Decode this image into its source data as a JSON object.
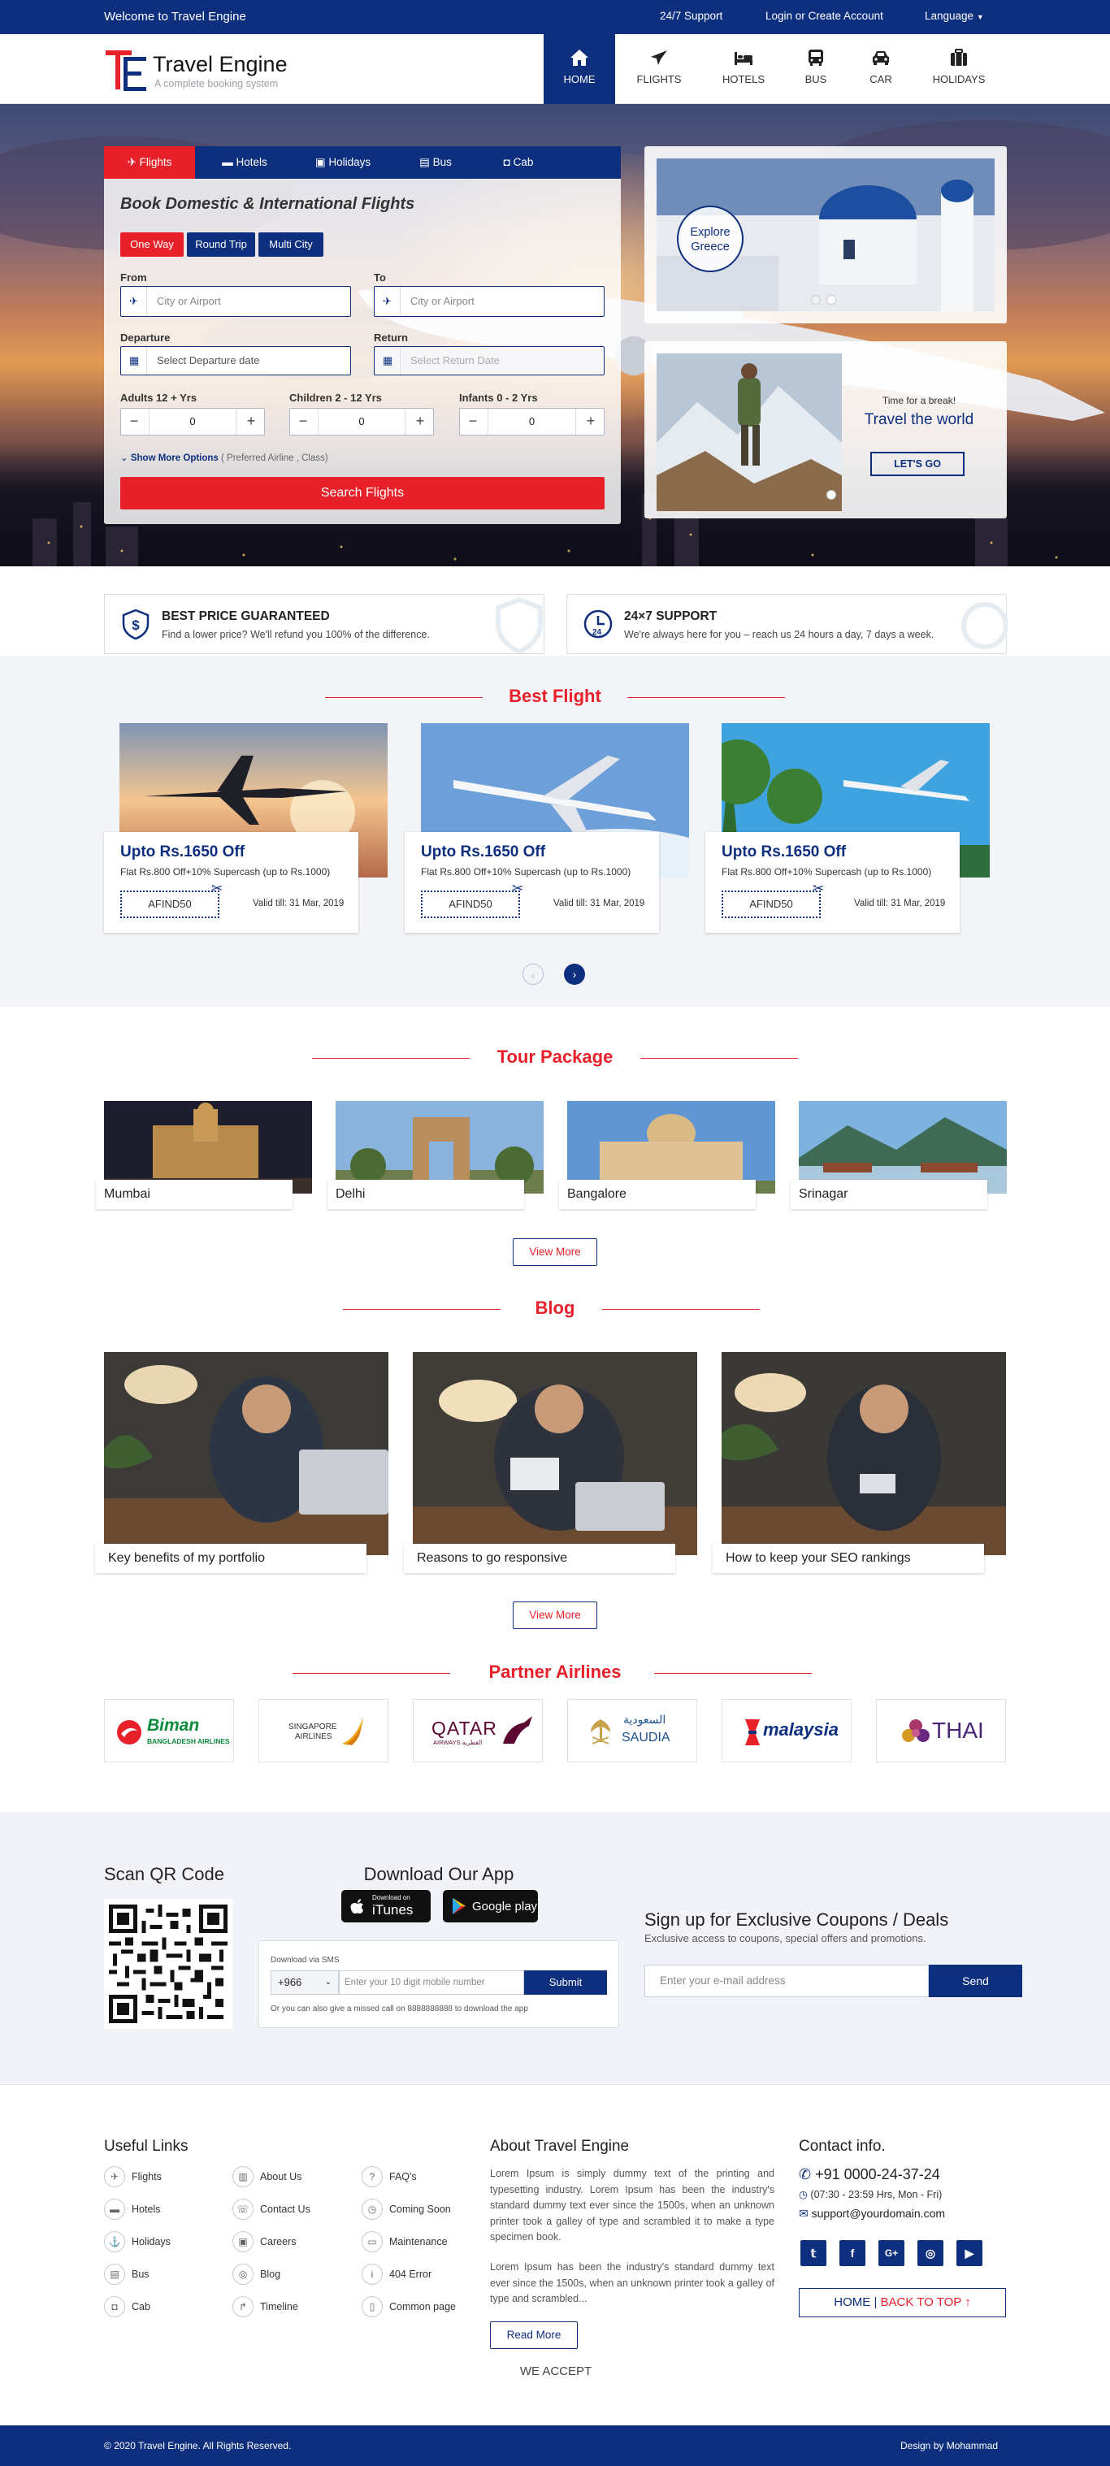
{
  "topbar": {
    "welcome": "Welcome to Travel Engine",
    "support": "24/7 Support",
    "login": "Login or Create Account",
    "language": "Language"
  },
  "logo": {
    "name": "Travel Engine",
    "tagline": "A complete booking system"
  },
  "nav": [
    {
      "label": "HOME",
      "icon": "home-icon"
    },
    {
      "label": "FLIGHTS",
      "icon": "plane-icon"
    },
    {
      "label": "HOTELS",
      "icon": "bed-icon"
    },
    {
      "label": "BUS",
      "icon": "bus-icon"
    },
    {
      "label": "CAR",
      "icon": "car-icon"
    },
    {
      "label": "HOLIDAYS",
      "icon": "suitcase-icon"
    }
  ],
  "search": {
    "tabs": [
      "Flights",
      "Hotels",
      "Holidays",
      "Bus",
      "Cab"
    ],
    "title": "Book Domestic & International Flights",
    "trip_types": [
      "One Way",
      "Round Trip",
      "Multi City"
    ],
    "from_label": "From",
    "from_placeholder": "City or Airport",
    "to_label": "To",
    "to_placeholder": "City or Airport",
    "departure_label": "Departure",
    "departure_placeholder": "Select Departure date",
    "return_label": "Return",
    "return_placeholder": "Select Return Date",
    "adults_label": "Adults 12 + Yrs",
    "adults_value": "0",
    "children_label": "Children 2 - 12 Yrs",
    "children_value": "0",
    "infants_label": "Infants 0 - 2 Yrs",
    "infants_value": "0",
    "more_options": "Show More Options",
    "more_hint": "( Preferred Airline , Class)",
    "button": "Search Flights"
  },
  "promo": {
    "explore_line1": "Explore",
    "explore_line2": "Greece",
    "break_text": "Time for a break!",
    "travel_text": "Travel the world",
    "go_button": "LET'S GO"
  },
  "features": [
    {
      "title": "BEST PRICE GUARANTEED",
      "text": "Find a lower price? We'll refund you 100% of the difference."
    },
    {
      "title": "24×7 SUPPORT",
      "text": "We're always here for you – reach us 24 hours a day, 7 days a week."
    }
  ],
  "best_flight": {
    "title": "Best Flight",
    "cards": [
      {
        "offer": "Upto Rs.1650 Off",
        "desc": "Flat Rs.800 Off+10% Supercash (up to Rs.1000)",
        "code": "AFIND50",
        "valid": "Valid till: 31 Mar, 2019"
      },
      {
        "offer": "Upto Rs.1650 Off",
        "desc": "Flat Rs.800 Off+10% Supercash (up to Rs.1000)",
        "code": "AFIND50",
        "valid": "Valid till: 31 Mar, 2019"
      },
      {
        "offer": "Upto Rs.1650 Off",
        "desc": "Flat Rs.800 Off+10% Supercash (up to Rs.1000)",
        "code": "AFIND50",
        "valid": "Valid till: 31 Mar, 2019"
      }
    ]
  },
  "tour": {
    "title": "Tour Package",
    "items": [
      "Mumbai",
      "Delhi",
      "Bangalore",
      "Srinagar"
    ],
    "view_more": "View More"
  },
  "blog": {
    "title": "Blog",
    "items": [
      "Key benefits of my portfolio",
      "Reasons to go responsive",
      "How to keep your SEO rankings"
    ],
    "view_more": "View More"
  },
  "airlines": {
    "title": "Partner Airlines",
    "logos": [
      "Biman",
      "BANGLADESH AIRLINES",
      "SINGAPORE",
      "AIRLINES",
      "QATAR",
      "AIRWAYS القطرية",
      "السعودية",
      "SAUDIA",
      "malaysia",
      "THAI"
    ]
  },
  "app": {
    "qr_title": "Scan QR Code",
    "download_title": "Download Our App",
    "itunes_small": "Download on",
    "itunes": "iTunes",
    "google": "Google play",
    "sms_label": "Download via SMS",
    "country_code": "+966",
    "mobile_placeholder": "Enter your 10 digit mobile number",
    "submit": "Submit",
    "missed_call": "Or you can also give a missed call on 8888888888 to download the app",
    "signup_title": "Sign up for Exclusive Coupons / Deals",
    "signup_sub": "Exclusive access to coupons, special offers and promotions.",
    "email_placeholder": "Enter your e-mail address",
    "send": "Send"
  },
  "footer": {
    "useful_title": "Useful Links",
    "links": [
      "Flights",
      "Hotels",
      "Holidays",
      "Bus",
      "Cab",
      "About Us",
      "Contact Us",
      "Careers",
      "Blog",
      "Timeline",
      "FAQ's",
      "Coming Soon",
      "Maintenance",
      "404 Error",
      "Common page"
    ],
    "about_title": "About Travel Engine",
    "about_p1": "Lorem Ipsum is simply dummy text of the printing and typesetting industry. Lorem Ipsum has been the industry's standard dummy text ever since the 1500s, when an unknown printer took a galley of type and scrambled it to make a type specimen book.",
    "about_p2": "Lorem Ipsum has been the industry's standard dummy text ever since the 1500s, when an unknown printer took a galley of type and scrambled...",
    "read_more": "Read More",
    "we_accept": "WE ACCEPT",
    "contact_title": "Contact info.",
    "phone": "+91 0000-24-37-24",
    "hours": "(07:30 - 23:59 Hrs, Mon - Fri)",
    "email": "support@yourdomain.com",
    "home": "HOME",
    "back_to_top": "BACK TO TOP",
    "copyright": "© 2020 Travel Engine. All Rights Reserved.",
    "design": "Design by Mohammad"
  },
  "colors": {
    "primary": "#0d2f7e",
    "accent": "#e8202a"
  }
}
